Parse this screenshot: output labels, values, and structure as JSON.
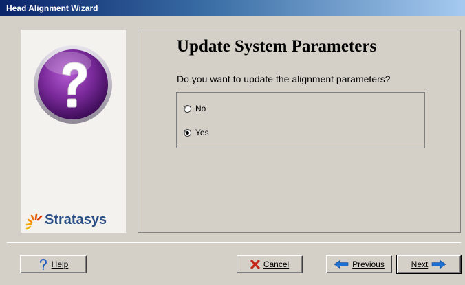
{
  "window": {
    "title": "Head Alignment Wizard"
  },
  "sidebar": {
    "icon": "question-mark-icon",
    "brand": "Stratasys",
    "brand_color": "#2a4f86"
  },
  "page": {
    "heading": "Update System Parameters",
    "question": "Do you want to update the alignment parameters?",
    "options": [
      {
        "label": "No",
        "selected": false
      },
      {
        "label": "Yes",
        "selected": true
      }
    ]
  },
  "buttons": {
    "help": {
      "label": "Help",
      "icon": "question-icon"
    },
    "cancel": {
      "label": "Cancel",
      "icon": "red-x-icon"
    },
    "previous": {
      "label": "Previous",
      "icon": "arrow-left-icon"
    },
    "next": {
      "label": "Next",
      "icon": "arrow-right-icon"
    }
  },
  "colors": {
    "title_bar_start": "#0a246a",
    "title_bar_end": "#a6caf0",
    "window_bg": "#d4d0c8",
    "accent_blue": "#1f6fd1",
    "cancel_red": "#c2261a",
    "icon_purple": "#7a2a9a"
  }
}
